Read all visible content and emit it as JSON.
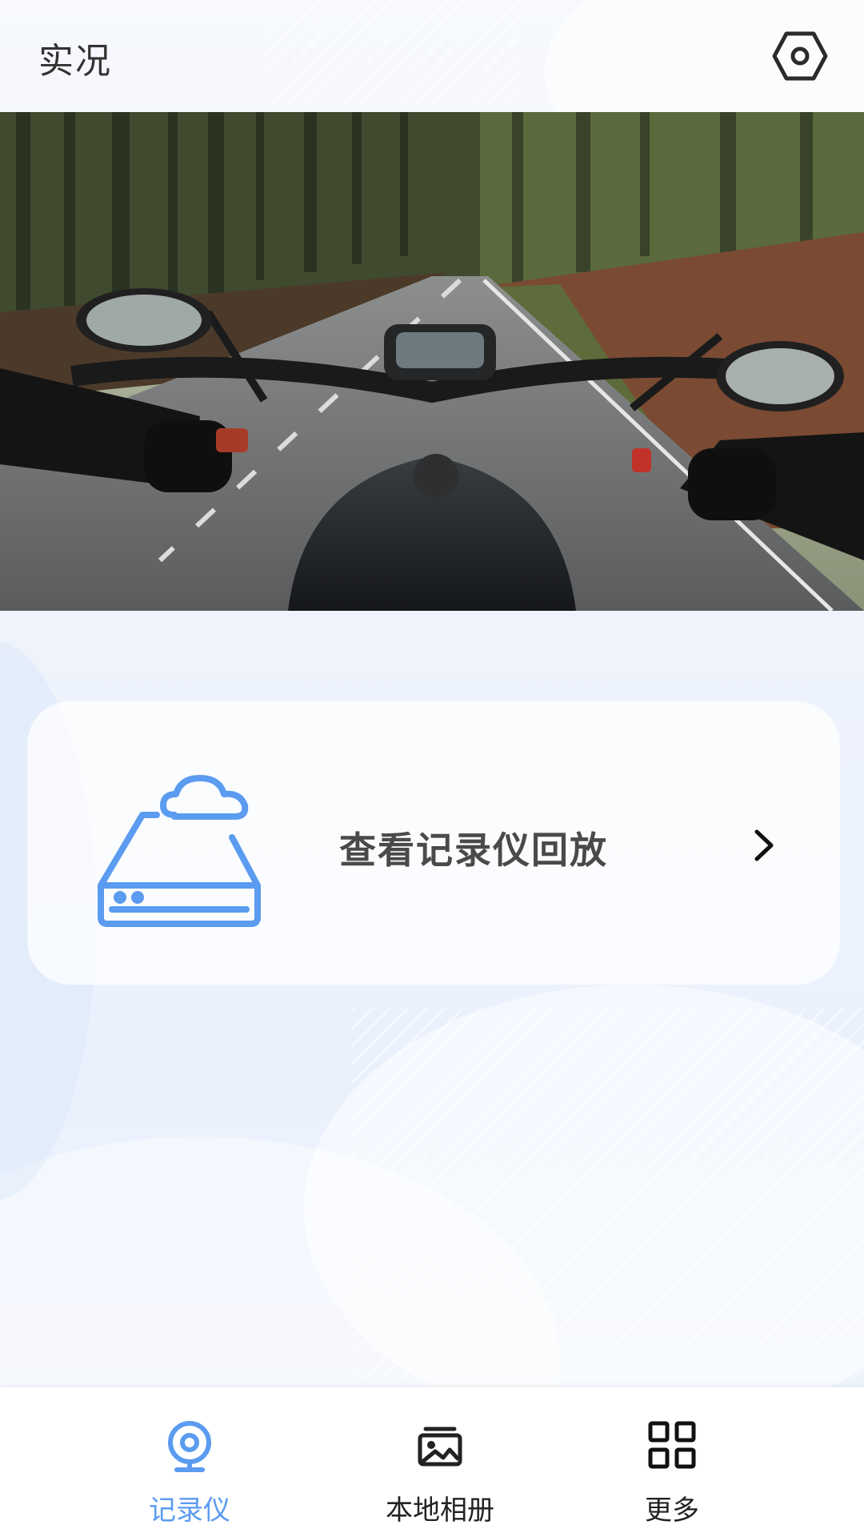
{
  "header": {
    "title": "实况",
    "settings_icon": "hexagon-settings-icon"
  },
  "live_view": {
    "image": "motorcycle-first-person-road-photo"
  },
  "playback_card": {
    "label": "查看记录仪回放",
    "icon": "cloud-storage-drive-icon",
    "chevron_icon": "chevron-right-icon"
  },
  "tab_bar": {
    "items": [
      {
        "label": "记录仪",
        "icon": "camera-icon",
        "active": true
      },
      {
        "label": "本地相册",
        "icon": "album-icon",
        "active": false
      },
      {
        "label": "更多",
        "icon": "grid-icon",
        "active": false
      }
    ]
  },
  "colors": {
    "accent": "#5b9bf0",
    "text": "#333333",
    "background": "#eef3fc"
  }
}
